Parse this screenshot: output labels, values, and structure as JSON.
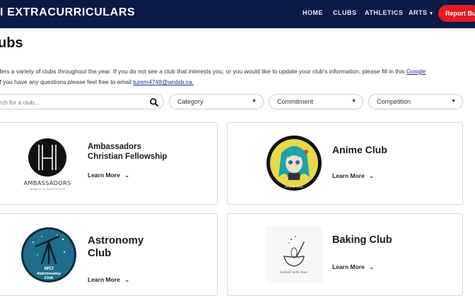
{
  "navbar": {
    "brand": "I EXTRACURRICULARS",
    "links": [
      "HOME",
      "CLUBS",
      "ATHLETICS",
      "ARTS"
    ],
    "report_button": "Report Bu"
  },
  "page": {
    "title": "ubs",
    "intro_line1_text": "ffers a variety of clubs throughout the year. If you do not see a club that interests you, or you would like to update your club's information, please fill in this ",
    "intro_line1_link": "Google",
    "intro_line2_text": " If you have any questions please feel free to email ",
    "intro_line2_email": "turem4748@wrdsb.ca."
  },
  "filters": {
    "search_placeholder": "rch for a club...",
    "category": "Category",
    "commitment": "Commitment",
    "competition": "Competition"
  },
  "clubs": [
    {
      "title_line1": "Ambassadors",
      "title_line2": "Christian Fellowship",
      "learn_more": "Learn More",
      "logo_text": "AMBASSADORS",
      "logo_subtext": "WATERLOO COLLEGIATE INSTITUTE"
    },
    {
      "title_line1": "Anime Club",
      "learn_more": "Learn More",
      "logo_text": "Anime Club"
    },
    {
      "title_line1": "Astronomy",
      "title_line2": "Club",
      "learn_more": "Learn More",
      "logo_text_1": "WCI",
      "logo_text_2": "Astronomy",
      "logo_text_3": "Club"
    },
    {
      "title_line1": "Baking Club",
      "learn_more": "Learn More",
      "logo_text": "baked with love"
    }
  ],
  "colors": {
    "navbar_bg": "#0b1a47",
    "report_button": "#e31b23",
    "link": "#1e2f88"
  }
}
